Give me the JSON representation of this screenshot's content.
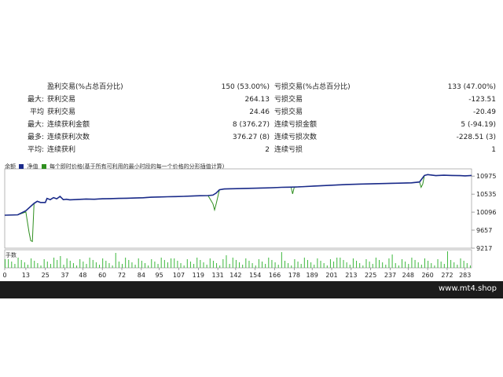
{
  "stats": {
    "rows": [
      {
        "label1": "",
        "label2": "盈利交易(%占总百分比)",
        "value1": "150 (53.00%)",
        "label3": "亏损交易(%占总百分比)",
        "value2": "133 (47.00%)"
      },
      {
        "label1": "最大:",
        "label2": "获利交易",
        "value1": "264.13",
        "label3": "亏损交易",
        "value2": "-123.51"
      },
      {
        "label1": "平均",
        "label2": "获利交易",
        "value1": "24.46",
        "label3": "亏损交易",
        "value2": "-20.49"
      },
      {
        "label1": "最大:",
        "label2": "连续获利金额",
        "value1": "8 (376.27)",
        "label3": "连续亏损金额",
        "value2": "5 (-94.19)"
      },
      {
        "label1": "最多:",
        "label2": "连续获利次数",
        "value1": "376.27 (8)",
        "label3": "连续亏损次数",
        "value2": "-228.51 (3)"
      },
      {
        "label1": "平均:",
        "label2": "连续获利",
        "value1": "2",
        "label3": "连续亏损",
        "value2": "1"
      }
    ]
  },
  "chart": {
    "legend_balance": "余额",
    "legend_equity": "净值",
    "legend_text": "每个即时价格(基于所有可利用的最小时段的每一个价格的分形插值计算)",
    "volume_label": "手数",
    "balance_color": "#1a2a8a",
    "equity_color": "#2f8f1f",
    "volume_color": "#3cb83c"
  },
  "chart_data": {
    "type": "line",
    "y_ticks": [
      9217,
      9657,
      10096,
      10535,
      10975
    ],
    "x_ticks": [
      0,
      13,
      25,
      37,
      48,
      60,
      72,
      84,
      95,
      107,
      119,
      131,
      142,
      154,
      166,
      178,
      189,
      201,
      213,
      225,
      237,
      248,
      260,
      272,
      283
    ],
    "ylim": [
      9217,
      11150
    ],
    "xlim": [
      0,
      287
    ],
    "series": [
      {
        "key": "balance",
        "x": [
          0,
          8,
          13,
          18,
          20,
          22,
          25,
          26,
          28,
          30,
          32,
          34,
          36,
          38,
          40,
          45,
          50,
          55,
          60,
          65,
          70,
          75,
          80,
          85,
          90,
          95,
          100,
          105,
          110,
          115,
          120,
          125,
          128,
          130,
          132,
          135,
          140,
          145,
          150,
          155,
          160,
          165,
          170,
          175,
          180,
          185,
          190,
          195,
          200,
          210,
          220,
          230,
          240,
          250,
          255,
          258,
          260,
          262,
          265,
          270,
          275,
          280,
          283,
          287
        ],
        "y": [
          10020,
          10030,
          10130,
          10310,
          10360,
          10330,
          10330,
          10430,
          10400,
          10450,
          10420,
          10480,
          10400,
          10410,
          10395,
          10405,
          10415,
          10410,
          10420,
          10425,
          10430,
          10435,
          10440,
          10445,
          10460,
          10465,
          10470,
          10475,
          10480,
          10488,
          10495,
          10500,
          10510,
          10560,
          10640,
          10660,
          10665,
          10670,
          10675,
          10680,
          10685,
          10690,
          10700,
          10705,
          10710,
          10720,
          10730,
          10740,
          10750,
          10770,
          10780,
          10790,
          10800,
          10810,
          10830,
          10990,
          11010,
          11000,
          10985,
          10995,
          10990,
          10985,
          10980,
          10990
        ]
      },
      {
        "key": "equity",
        "x": [
          0,
          8,
          13,
          15,
          16,
          17,
          18,
          20,
          22,
          25,
          26,
          28,
          30,
          32,
          34,
          36,
          38,
          40,
          45,
          50,
          55,
          60,
          70,
          80,
          90,
          100,
          110,
          120,
          125,
          128,
          129,
          130,
          132,
          135,
          140,
          150,
          160,
          170,
          176,
          177,
          178,
          180,
          190,
          200,
          210,
          220,
          230,
          240,
          250,
          255,
          256,
          257,
          258,
          260,
          262,
          265,
          270,
          275,
          280,
          283,
          287
        ],
        "y": [
          10020,
          10030,
          10100,
          9600,
          9400,
          9380,
          10300,
          10360,
          10330,
          10330,
          10430,
          10400,
          10450,
          10420,
          10480,
          10400,
          10410,
          10395,
          10405,
          10415,
          10410,
          10420,
          10430,
          10440,
          10460,
          10470,
          10480,
          10495,
          10500,
          10300,
          10150,
          10300,
          10640,
          10660,
          10665,
          10675,
          10685,
          10700,
          10706,
          10540,
          10700,
          10710,
          10730,
          10750,
          10770,
          10780,
          10790,
          10800,
          10810,
          10830,
          10700,
          10780,
          10990,
          11010,
          11000,
          10985,
          10995,
          10990,
          10985,
          10980,
          10990
        ]
      }
    ]
  }
}
